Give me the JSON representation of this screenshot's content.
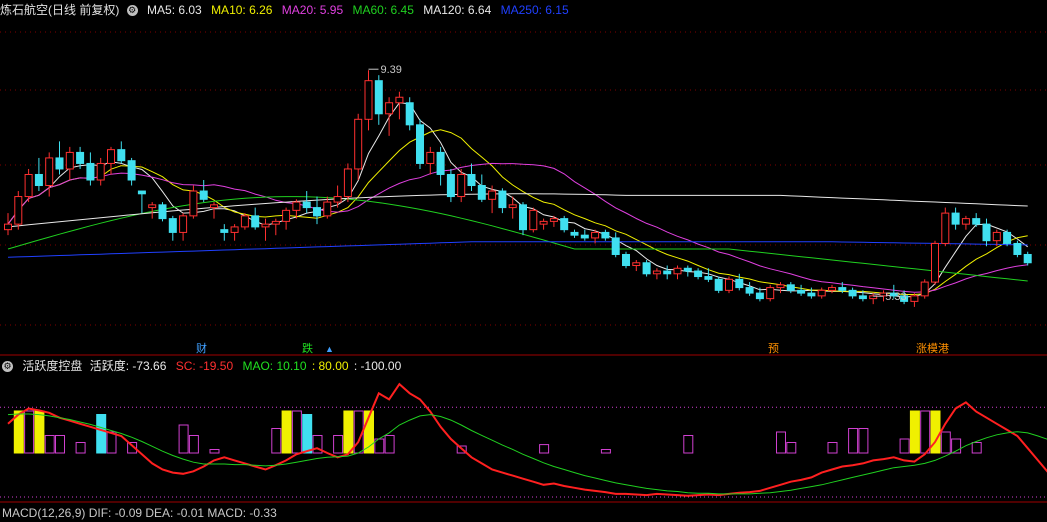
{
  "main_header": {
    "title": "炼石航空(日线 前复权)",
    "gear_icon": "gear-icon",
    "ma_items": [
      {
        "label": "MA5: 6.03",
        "color": "#e8e8e8"
      },
      {
        "label": "MA10: 6.26",
        "color": "#f0f000"
      },
      {
        "label": "MA20: 5.95",
        "color": "#e040e0"
      },
      {
        "label": "MA60: 6.45",
        "color": "#20d020"
      },
      {
        "label": "MA120: 6.64",
        "color": "#e8e8e8"
      },
      {
        "label": "MA250: 6.15",
        "color": "#2040ff"
      }
    ]
  },
  "indicator_header": {
    "title": "活跃度控盘",
    "items": [
      {
        "label": "活跃度: -73.66",
        "color": "#e8e8e8"
      },
      {
        "label": "SC: -19.50",
        "color": "#ff3030"
      },
      {
        "label": "MAO: 10.10",
        "color": "#20e020"
      },
      {
        "label": ": 80.00",
        "color": "#f0f000"
      },
      {
        "label": ": -100.00",
        "color": "#e8e8e8"
      }
    ]
  },
  "bottom_header": {
    "text": "MACD(12,26,9) DIF: -0.09  DEA: -0.01  MACD: -0.33"
  },
  "event_tags": [
    {
      "id": "t1",
      "text": "财",
      "color": "#40a0ff"
    },
    {
      "id": "t2",
      "text": "跌",
      "color": "#20e020"
    },
    {
      "id": "t3",
      "text": "预",
      "color": "#ff9000"
    },
    {
      "id": "t4",
      "text": "涨模港",
      "color": "#ff9000"
    }
  ],
  "colors": {
    "up": "#ff3030",
    "down": "#40e0f0",
    "grid": "#800000",
    "ma5": "#e8e8e8",
    "ma10": "#f0f000",
    "ma20": "#e040e0",
    "ma60": "#20d020",
    "ma120": "#e8e8e8",
    "ma250": "#2040ff",
    "activity_line": "#ff2020",
    "activity_ma": "#20d020",
    "bar_outline": "#d040d0",
    "bar_yellow": "#f0f000",
    "bar_cyan": "#40e0f0"
  },
  "chart_data": [
    {
      "type": "candlestick",
      "title": "炼石航空(日线 前复权)",
      "ylim": [
        4.5,
        10.3
      ],
      "price_labels": [
        {
          "text": "9.39",
          "value": 9.39,
          "index": 35
        },
        {
          "text": "5.33",
          "value": 5.33,
          "index": 84
        }
      ],
      "candles": [
        [
          6.5,
          6.8,
          6.4,
          6.6
        ],
        [
          6.6,
          7.2,
          6.5,
          7.1
        ],
        [
          7.1,
          7.6,
          7.0,
          7.5
        ],
        [
          7.5,
          7.8,
          7.2,
          7.3
        ],
        [
          7.3,
          7.9,
          7.1,
          7.8
        ],
        [
          7.8,
          8.1,
          7.5,
          7.6
        ],
        [
          7.6,
          8.0,
          7.4,
          7.9
        ],
        [
          7.9,
          8.0,
          7.6,
          7.7
        ],
        [
          7.7,
          7.9,
          7.3,
          7.4
        ],
        [
          7.4,
          7.8,
          7.3,
          7.7
        ],
        [
          7.7,
          8.0,
          7.5,
          7.95
        ],
        [
          7.95,
          8.1,
          7.7,
          7.75
        ],
        [
          7.75,
          7.8,
          7.3,
          7.4
        ],
        [
          7.2,
          7.2,
          6.8,
          7.15
        ],
        [
          6.9,
          7.0,
          6.7,
          6.95
        ],
        [
          6.95,
          7.0,
          6.65,
          6.7
        ],
        [
          6.7,
          6.75,
          6.3,
          6.45
        ],
        [
          6.45,
          6.8,
          6.3,
          6.75
        ],
        [
          6.75,
          7.3,
          6.7,
          7.2
        ],
        [
          7.2,
          7.4,
          7.0,
          7.05
        ],
        [
          6.9,
          7.0,
          6.7,
          6.95
        ],
        [
          6.5,
          6.6,
          6.3,
          6.45
        ],
        [
          6.45,
          6.6,
          6.3,
          6.55
        ],
        [
          6.55,
          6.8,
          6.5,
          6.75
        ],
        [
          6.75,
          6.9,
          6.5,
          6.55
        ],
        [
          6.55,
          6.7,
          6.3,
          6.6
        ],
        [
          6.6,
          6.7,
          6.4,
          6.65
        ],
        [
          6.65,
          6.9,
          6.5,
          6.85
        ],
        [
          6.85,
          7.05,
          6.7,
          7.0
        ],
        [
          7.0,
          7.2,
          6.8,
          6.9
        ],
        [
          6.9,
          7.1,
          6.6,
          6.75
        ],
        [
          6.75,
          7.1,
          6.7,
          7.0
        ],
        [
          7.0,
          7.3,
          6.9,
          7.1
        ],
        [
          7.1,
          7.7,
          7.0,
          7.6
        ],
        [
          7.6,
          8.6,
          7.4,
          8.5
        ],
        [
          8.5,
          9.39,
          8.3,
          9.2
        ],
        [
          9.2,
          9.3,
          8.4,
          8.6
        ],
        [
          8.6,
          8.9,
          8.2,
          8.8
        ],
        [
          8.8,
          9.0,
          8.5,
          8.9
        ],
        [
          8.8,
          8.9,
          8.3,
          8.4
        ],
        [
          8.4,
          8.5,
          7.6,
          7.7
        ],
        [
          7.7,
          8.0,
          7.5,
          7.9
        ],
        [
          7.9,
          8.0,
          7.3,
          7.5
        ],
        [
          7.5,
          7.6,
          7.0,
          7.1
        ],
        [
          7.1,
          7.6,
          7.0,
          7.5
        ],
        [
          7.5,
          7.7,
          7.2,
          7.3
        ],
        [
          7.3,
          7.5,
          7.0,
          7.05
        ],
        [
          7.05,
          7.3,
          6.8,
          7.2
        ],
        [
          7.2,
          7.25,
          6.8,
          6.9
        ],
        [
          6.9,
          7.1,
          6.7,
          6.95
        ],
        [
          6.95,
          7.0,
          6.4,
          6.5
        ],
        [
          6.5,
          6.9,
          6.45,
          6.85
        ],
        [
          6.6,
          6.7,
          6.5,
          6.65
        ],
        [
          6.65,
          6.75,
          6.55,
          6.7
        ],
        [
          6.7,
          6.75,
          6.45,
          6.5
        ],
        [
          6.45,
          6.5,
          6.35,
          6.4
        ],
        [
          6.4,
          6.5,
          6.3,
          6.35
        ],
        [
          6.35,
          6.5,
          6.25,
          6.45
        ],
        [
          6.45,
          6.5,
          6.3,
          6.35
        ],
        [
          6.35,
          6.45,
          6.0,
          6.05
        ],
        [
          6.05,
          6.1,
          5.8,
          5.85
        ],
        [
          5.85,
          5.95,
          5.75,
          5.9
        ],
        [
          5.9,
          5.95,
          5.65,
          5.7
        ],
        [
          5.7,
          5.8,
          5.6,
          5.75
        ],
        [
          5.75,
          5.85,
          5.6,
          5.7
        ],
        [
          5.7,
          5.85,
          5.6,
          5.8
        ],
        [
          5.8,
          5.85,
          5.65,
          5.75
        ],
        [
          5.75,
          5.8,
          5.6,
          5.65
        ],
        [
          5.65,
          5.8,
          5.55,
          5.6
        ],
        [
          5.6,
          5.65,
          5.35,
          5.4
        ],
        [
          5.4,
          5.65,
          5.35,
          5.6
        ],
        [
          5.6,
          5.7,
          5.4,
          5.45
        ],
        [
          5.45,
          5.55,
          5.3,
          5.35
        ],
        [
          5.35,
          5.45,
          5.2,
          5.25
        ],
        [
          5.25,
          5.5,
          5.2,
          5.45
        ],
        [
          5.45,
          5.55,
          5.35,
          5.5
        ],
        [
          5.5,
          5.55,
          5.35,
          5.4
        ],
        [
          5.4,
          5.5,
          5.3,
          5.35
        ],
        [
          5.35,
          5.45,
          5.25,
          5.3
        ],
        [
          5.3,
          5.45,
          5.25,
          5.4
        ],
        [
          5.4,
          5.5,
          5.35,
          5.45
        ],
        [
          5.45,
          5.55,
          5.35,
          5.4
        ],
        [
          5.4,
          5.45,
          5.25,
          5.3
        ],
        [
          5.3,
          5.4,
          5.2,
          5.25
        ],
        [
          5.25,
          5.35,
          5.15,
          5.3
        ],
        [
          5.3,
          5.4,
          5.2,
          5.35
        ],
        [
          5.35,
          5.5,
          5.25,
          5.3
        ],
        [
          5.3,
          5.4,
          5.15,
          5.2
        ],
        [
          5.2,
          5.35,
          5.1,
          5.3
        ],
        [
          5.3,
          5.6,
          5.25,
          5.55
        ],
        [
          5.55,
          6.3,
          5.5,
          6.25
        ],
        [
          6.25,
          6.9,
          6.2,
          6.8
        ],
        [
          6.8,
          6.9,
          6.5,
          6.6
        ],
        [
          6.6,
          6.75,
          6.5,
          6.7
        ],
        [
          6.7,
          6.8,
          6.55,
          6.6
        ],
        [
          6.6,
          6.7,
          6.2,
          6.3
        ],
        [
          6.3,
          6.5,
          6.2,
          6.45
        ],
        [
          6.45,
          6.5,
          6.2,
          6.25
        ],
        [
          6.25,
          6.3,
          6.0,
          6.05
        ],
        [
          6.05,
          6.1,
          5.85,
          5.9
        ]
      ],
      "ma_lines": [
        {
          "name": "MA5",
          "color_key": "ma5"
        },
        {
          "name": "MA10",
          "color_key": "ma10"
        },
        {
          "name": "MA20",
          "color_key": "ma20"
        },
        {
          "name": "MA60",
          "color_key": "ma60"
        },
        {
          "name": "MA120",
          "color_key": "ma120"
        },
        {
          "name": "MA250",
          "color_key": "ma250"
        }
      ]
    },
    {
      "type": "line",
      "title": "活跃度控盘",
      "ylim": [
        -105,
        100
      ],
      "series": [
        {
          "name": "活跃度",
          "color_key": "activity_line",
          "values": [
            20,
            35,
            45,
            42,
            38,
            30,
            25,
            20,
            15,
            10,
            5,
            0,
            -15,
            -30,
            -45,
            -55,
            -60,
            -62,
            -58,
            -50,
            -40,
            -35,
            -40,
            -45,
            -50,
            -55,
            -48,
            -40,
            -30,
            -25,
            -20,
            -28,
            -35,
            -30,
            -10,
            30,
            70,
            60,
            85,
            70,
            60,
            40,
            15,
            -5,
            -20,
            -35,
            -45,
            -55,
            -60,
            -65,
            -70,
            -75,
            -80,
            -78,
            -82,
            -85,
            -88,
            -90,
            -92,
            -95,
            -95,
            -96,
            -97,
            -95,
            -96,
            -97,
            -98,
            -97,
            -96,
            -97,
            -95,
            -93,
            -92,
            -90,
            -85,
            -80,
            -75,
            -72,
            -68,
            -60,
            -55,
            -50,
            -48,
            -45,
            -40,
            -38,
            -35,
            -40,
            -42,
            -30,
            -10,
            20,
            45,
            55,
            40,
            30,
            20,
            10,
            0,
            -20,
            -40,
            -60,
            -73.66
          ]
        },
        {
          "name": "MAO",
          "color_key": "activity_ma",
          "values": [
            35,
            36,
            36,
            35,
            33,
            30,
            27,
            23,
            19,
            14,
            9,
            4,
            -2,
            -9,
            -17,
            -25,
            -32,
            -38,
            -43,
            -46,
            -46,
            -46,
            -47,
            -47,
            -48,
            -49,
            -48,
            -46,
            -43,
            -40,
            -37,
            -35,
            -34,
            -33,
            -28,
            -18,
            -5,
            5,
            18,
            26,
            33,
            35,
            32,
            26,
            18,
            9,
            1,
            -7,
            -15,
            -22,
            -30,
            -37,
            -44,
            -50,
            -55,
            -60,
            -65,
            -69,
            -73,
            -77,
            -80,
            -83,
            -86,
            -88,
            -90,
            -91,
            -93,
            -94,
            -94,
            -95,
            -95,
            -95,
            -95,
            -94,
            -93,
            -91,
            -89,
            -86,
            -83,
            -80,
            -76,
            -72,
            -68,
            -64,
            -60,
            -56,
            -52,
            -50,
            -48,
            -45,
            -40,
            -33,
            -25,
            -16,
            -9,
            -3,
            2,
            5,
            7,
            5,
            0,
            -6,
            10.1
          ]
        }
      ],
      "bars": [
        {
          "i": 1,
          "v": 60,
          "kind": "yellow"
        },
        {
          "i": 2,
          "v": 60,
          "kind": "outline"
        },
        {
          "i": 3,
          "v": 60,
          "kind": "yellow"
        },
        {
          "i": 4,
          "v": 25,
          "kind": "outline"
        },
        {
          "i": 5,
          "v": 25,
          "kind": "outline"
        },
        {
          "i": 7,
          "v": 15,
          "kind": "outline"
        },
        {
          "i": 9,
          "v": 55,
          "kind": "cyan"
        },
        {
          "i": 10,
          "v": 30,
          "kind": "outline"
        },
        {
          "i": 12,
          "v": 15,
          "kind": "outline"
        },
        {
          "i": 17,
          "v": 40,
          "kind": "outline"
        },
        {
          "i": 18,
          "v": 25,
          "kind": "outline"
        },
        {
          "i": 20,
          "v": 5,
          "kind": "outline"
        },
        {
          "i": 26,
          "v": 35,
          "kind": "outline"
        },
        {
          "i": 27,
          "v": 60,
          "kind": "yellow"
        },
        {
          "i": 28,
          "v": 60,
          "kind": "outline"
        },
        {
          "i": 29,
          "v": 55,
          "kind": "cyan"
        },
        {
          "i": 30,
          "v": 25,
          "kind": "outline"
        },
        {
          "i": 32,
          "v": 25,
          "kind": "outline"
        },
        {
          "i": 33,
          "v": 60,
          "kind": "yellow"
        },
        {
          "i": 34,
          "v": 60,
          "kind": "outline"
        },
        {
          "i": 35,
          "v": 60,
          "kind": "yellow"
        },
        {
          "i": 36,
          "v": 20,
          "kind": "outline"
        },
        {
          "i": 37,
          "v": 25,
          "kind": "outline"
        },
        {
          "i": 44,
          "v": 10,
          "kind": "outline"
        },
        {
          "i": 52,
          "v": 12,
          "kind": "outline"
        },
        {
          "i": 58,
          "v": 5,
          "kind": "outline"
        },
        {
          "i": 66,
          "v": 25,
          "kind": "outline"
        },
        {
          "i": 75,
          "v": 30,
          "kind": "outline"
        },
        {
          "i": 76,
          "v": 15,
          "kind": "outline"
        },
        {
          "i": 80,
          "v": 15,
          "kind": "outline"
        },
        {
          "i": 82,
          "v": 35,
          "kind": "outline"
        },
        {
          "i": 83,
          "v": 35,
          "kind": "outline"
        },
        {
          "i": 87,
          "v": 20,
          "kind": "outline"
        },
        {
          "i": 88,
          "v": 60,
          "kind": "yellow"
        },
        {
          "i": 89,
          "v": 60,
          "kind": "outline"
        },
        {
          "i": 90,
          "v": 60,
          "kind": "yellow"
        },
        {
          "i": 91,
          "v": 30,
          "kind": "outline"
        },
        {
          "i": 92,
          "v": 20,
          "kind": "outline"
        },
        {
          "i": 94,
          "v": 15,
          "kind": "outline"
        }
      ],
      "ref_lines": [
        80,
        -100
      ]
    }
  ]
}
